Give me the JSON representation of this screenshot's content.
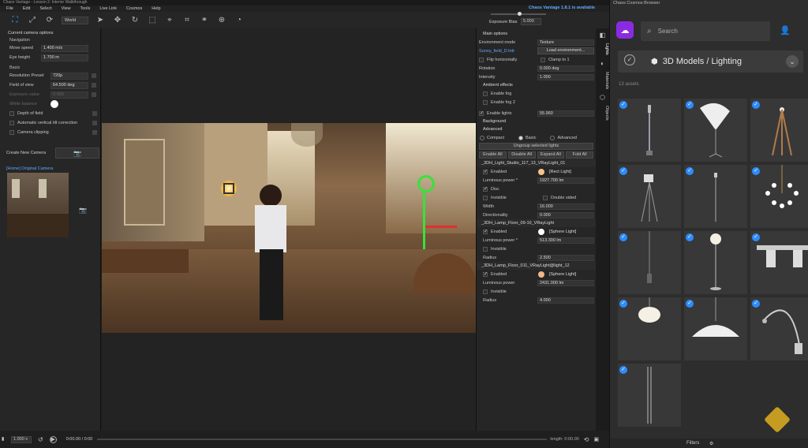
{
  "window": {
    "title": "Chaos Vantage - Lesson 2: Interior Walkthrough"
  },
  "menu": [
    "File",
    "Edit",
    "Select",
    "View",
    "Tools",
    "Live Link",
    "Cosmos",
    "Help"
  ],
  "toolbar": {
    "space": "World"
  },
  "header": {
    "update_notice": "Chaos Vantage 1.8.1 is available",
    "exposure_label": "Exposure Bias",
    "exposure_value": "5.000",
    "exposure_level": 0.52
  },
  "left": {
    "section_title": "Current camera options",
    "navigation_label": "Navigation",
    "move_speed_label": "Move speed",
    "move_speed": "1.400 m/s",
    "eye_height_label": "Eye height",
    "eye_height": "1.700 m",
    "basic_label": "Basic",
    "resolution_label": "Resolution Preset",
    "resolution": "720p",
    "fov_label": "Field of view",
    "fov": "64.500 deg",
    "exposure_label": "Exposure value",
    "exposure": "0.000",
    "white_balance_label": "White balance",
    "depth_of_field": "Depth of field",
    "auto_tilt": "Automatic vertical tilt correction",
    "camera_clipping": "Camera clipping",
    "create_camera": "Create New Camera",
    "camera_name": "[Home] Original Camera"
  },
  "timeline": {
    "speed": "1.000 x",
    "time": "0:00.00 / 0:00",
    "length": "length: 0:00.00"
  },
  "right": {
    "main_options": "Main options",
    "env_mode_label": "Environment mode",
    "env_mode": "Texture",
    "hdri_file": "Sunny_field_D.hdr",
    "load_env": "Load environment...",
    "flip_h": "Flip horizontally",
    "clamp": "Clamp to 1",
    "rotation_label": "Rotation",
    "rotation": "0.000 deg",
    "intensity_label": "Intensity",
    "intensity": "1.000",
    "ambient_effects": "Ambient effects",
    "enable_fog": "Enable fog",
    "enable_fog2": "Enable fog 2",
    "enable_lights": "Enable lights",
    "lights_value": "55.960",
    "background": "Background",
    "advanced": "Advanced",
    "modes": [
      "Compact",
      "Basic",
      "Advanced"
    ],
    "ungroup": "Ungroup selected lights",
    "buttons": [
      "Enable All",
      "Disable All",
      "Expand All",
      "Fold All"
    ],
    "lights": [
      {
        "name": "_3DH_Light_Studio_117_13_VRayLight_01",
        "enabled": "Enabled",
        "swatch_color": "#f5c28a",
        "type": "[Rect Light]",
        "power_label": "Luminous power *",
        "power": "1927.700 lm",
        "disc": "Disc",
        "invisible": "Invisible",
        "double": "Double sided",
        "width_label": "Width",
        "width": "16.000",
        "dir_label": "Directionality",
        "dir": "0.000"
      },
      {
        "name": "_3DH_Lamp_Floor_09-10_VRayLight",
        "enabled": "Enabled",
        "swatch_color": "#ffffff",
        "type": "[Sphere Light]",
        "power_label": "Luminous power *",
        "power": "513.300 lm",
        "invisible": "Invisible",
        "radius_label": "Radius",
        "radius": "2.500"
      },
      {
        "name": "_3DH_Lamp_Floor_011_VRayLight@light_12",
        "enabled": "Enabled",
        "swatch_color": "#f5b58a",
        "type": "[Sphere Light]",
        "power_label": "Luminous power",
        "power": "2431.000 lm",
        "invisible": "Invisible",
        "radius_label": "Radius",
        "radius": "4.000"
      }
    ]
  },
  "side_tabs": [
    "Lights",
    "Materials",
    "Objects"
  ],
  "cosmos": {
    "title": "Chaos Cosmos Browser",
    "search_placeholder": "Search",
    "category": "3D Models / Lighting",
    "asset_count": "13 assets",
    "filters": "Filters",
    "assets": [
      {
        "name": "Street lamp",
        "icon": "street-lamp-icon"
      },
      {
        "name": "Studio umbrella",
        "icon": "umbrella-light-icon"
      },
      {
        "name": "Tripod lamp",
        "icon": "tripod-lamp-icon"
      },
      {
        "name": "Spotlight tripod",
        "icon": "spot-tripod-icon"
      },
      {
        "name": "Floor lamp",
        "icon": "floor-lamp-icon"
      },
      {
        "name": "Sputnik chandelier",
        "icon": "chandelier-icon"
      },
      {
        "name": "Pendant light",
        "icon": "pendant-icon"
      },
      {
        "name": "Globe floor lamp",
        "icon": "globe-lamp-icon"
      },
      {
        "name": "Track spots",
        "icon": "track-spot-icon"
      },
      {
        "name": "Paper lantern",
        "icon": "lantern-icon"
      },
      {
        "name": "Dome pendant",
        "icon": "dome-pendant-icon"
      },
      {
        "name": "Arc lamp",
        "icon": "arc-lamp-icon"
      },
      {
        "name": "Slim floor lamp",
        "icon": "slim-lamp-icon"
      }
    ]
  }
}
